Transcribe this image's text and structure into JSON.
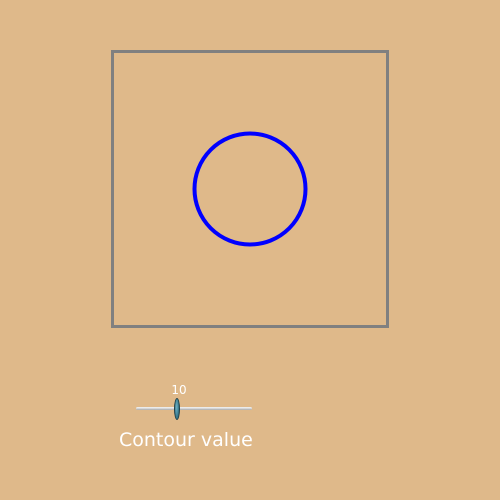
{
  "scene": {
    "background": "#DFB98A",
    "outline_color": "#808080",
    "contour_color": "#0000FF"
  },
  "slider": {
    "value": "10",
    "title": "Contour value",
    "thumb_color": "#3E7F92",
    "track_color": "#D8D8D8"
  }
}
